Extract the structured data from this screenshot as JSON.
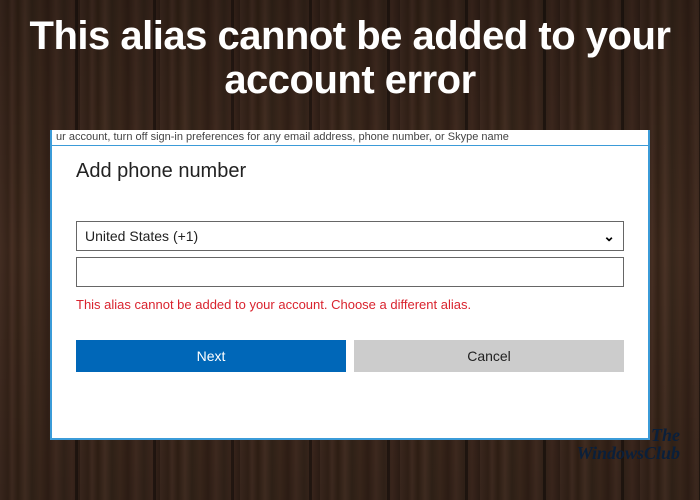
{
  "headline": "This alias cannot be added to your account error",
  "cutoff_text": "ur account, turn off sign-in preferences for any email address, phone number, or Skype name",
  "dialog": {
    "title": "Add phone number",
    "country_selected": "United States (+1)",
    "phone_value": "",
    "phone_placeholder": "",
    "error_message": "This alias cannot be added to your account. Choose a different alias.",
    "next_label": "Next",
    "cancel_label": "Cancel"
  },
  "watermark": {
    "line1": "The",
    "line2": "WindowsClub"
  }
}
